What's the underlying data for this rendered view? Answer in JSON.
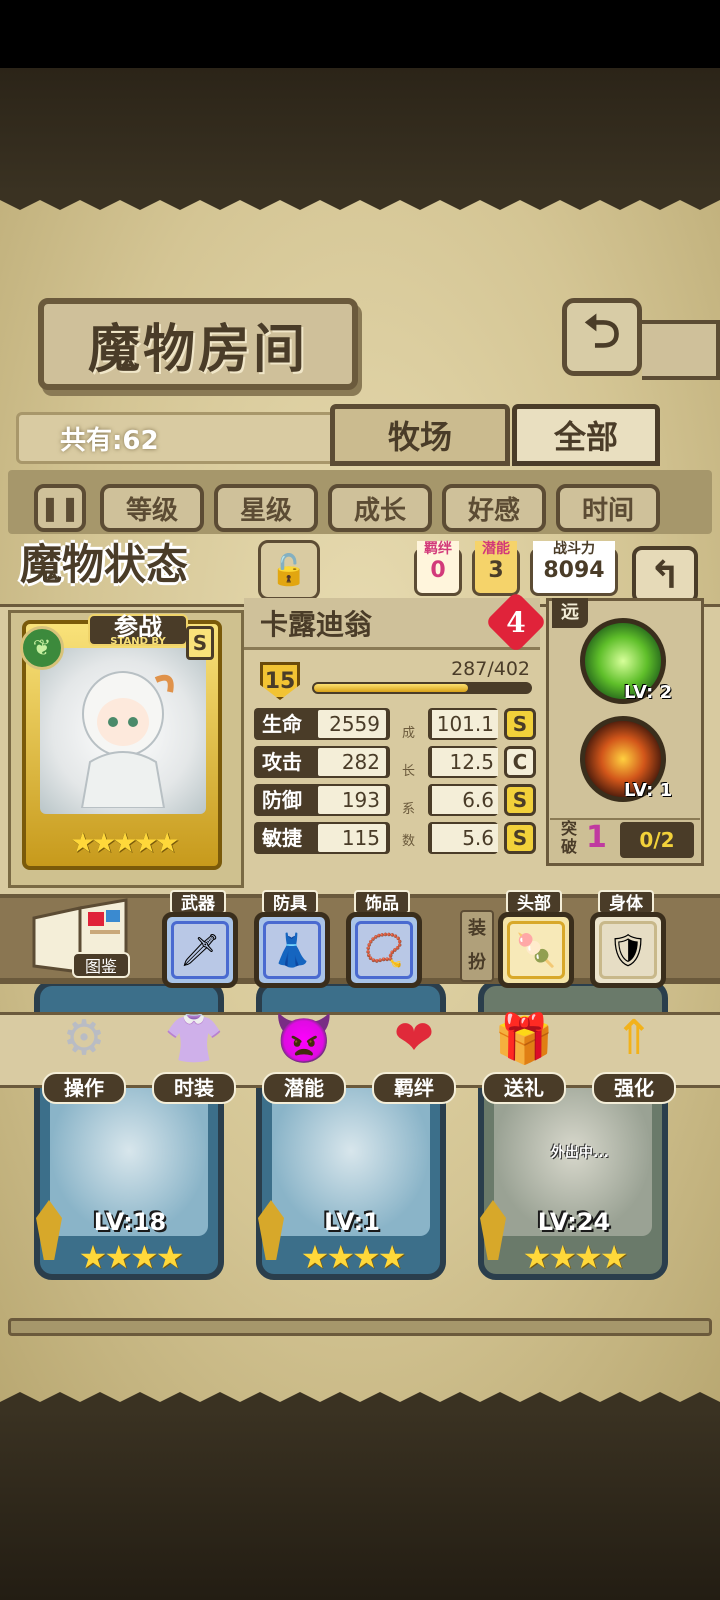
{
  "room": {
    "title": "魔物房间",
    "count_label": "共有:62",
    "tabs": [
      {
        "label": "牧场"
      },
      {
        "label": "全部"
      }
    ],
    "filters": [
      {
        "label": "等级"
      },
      {
        "label": "星级"
      },
      {
        "label": "成长"
      },
      {
        "label": "好感"
      },
      {
        "label": "时间"
      }
    ],
    "filter_toggle_icon": "pause-icon"
  },
  "status": {
    "title": "魔物状态",
    "lock_icon": "padlock-icon",
    "bond": {
      "label": "羁绊",
      "value": "0"
    },
    "potential": {
      "label": "潜能",
      "value": "3"
    },
    "power": {
      "label": "战斗力",
      "value": "8094"
    },
    "return_icon": "return-arrow-icon"
  },
  "monster": {
    "name": "卡露迪翁",
    "heart_level": "4",
    "standby_label": "参战",
    "standby_sub": "STAND BY",
    "rarity_badge": "S",
    "element_icon": "leaf-icon",
    "card_stars": "★★★★★",
    "level": "15",
    "exp_text": "287/402",
    "exp_fraction": 0.714,
    "range_tag": "远",
    "stats": [
      {
        "label": "生命",
        "value": "2559",
        "growth": "101.1",
        "grade": "S"
      },
      {
        "label": "攻击",
        "value": "282",
        "growth": "12.5",
        "grade": "C"
      },
      {
        "label": "防御",
        "value": "193",
        "growth": "6.6",
        "grade": "S"
      },
      {
        "label": "敏捷",
        "value": "115",
        "growth": "5.6",
        "grade": "S"
      }
    ],
    "growth_vertical": [
      "成",
      "长",
      "系",
      "数"
    ],
    "skills": [
      {
        "icon": "nature-skill-icon",
        "level": "LV: 2"
      },
      {
        "icon": "fire-sword-skill-icon",
        "level": "LV: 1"
      }
    ],
    "breakthrough": {
      "label": "突破",
      "value": "1",
      "progress": "0/2"
    }
  },
  "equipment": {
    "book_label": "图鉴",
    "slots": [
      {
        "tag": "武器",
        "icon": "sword-icon",
        "glyph": "🗡"
      },
      {
        "tag": "防具",
        "icon": "dress-armor-icon",
        "glyph": "👗"
      },
      {
        "tag": "饰品",
        "icon": "necklace-icon",
        "glyph": "📿"
      }
    ],
    "dress_label": "装扮",
    "dress_slots": [
      {
        "tag": "头部",
        "icon": "marshmallow-stick-icon",
        "glyph": "🍡"
      },
      {
        "tag": "身体",
        "icon": "crystal-armor-icon",
        "glyph": "🛡"
      }
    ]
  },
  "actions": [
    {
      "label": "操作",
      "icon": "gear-icon",
      "glyph": "⚙",
      "color": "#b9bcc4"
    },
    {
      "label": "时装",
      "icon": "outfit-icon",
      "glyph": "👚",
      "color": "#f2a8d8"
    },
    {
      "label": "潜能",
      "icon": "shadow-imp-icon",
      "glyph": "👿",
      "color": "#6a3ab8"
    },
    {
      "label": "羁绊",
      "icon": "hearts-icon",
      "glyph": "❤",
      "color": "#e02a3a"
    },
    {
      "label": "送礼",
      "icon": "gift-icon",
      "glyph": "🎁",
      "color": "#d23aa0"
    },
    {
      "label": "强化",
      "icon": "upgrade-arrows-icon",
      "glyph": "⇑",
      "color": "#f2b21a"
    }
  ],
  "monster_list": [
    {
      "level": "LV:18",
      "stars": "★★★★"
    },
    {
      "level": "LV:1",
      "stars": "★★★★"
    },
    {
      "level": "LV:24",
      "stars": "★★★★",
      "status": "外出中..."
    }
  ]
}
